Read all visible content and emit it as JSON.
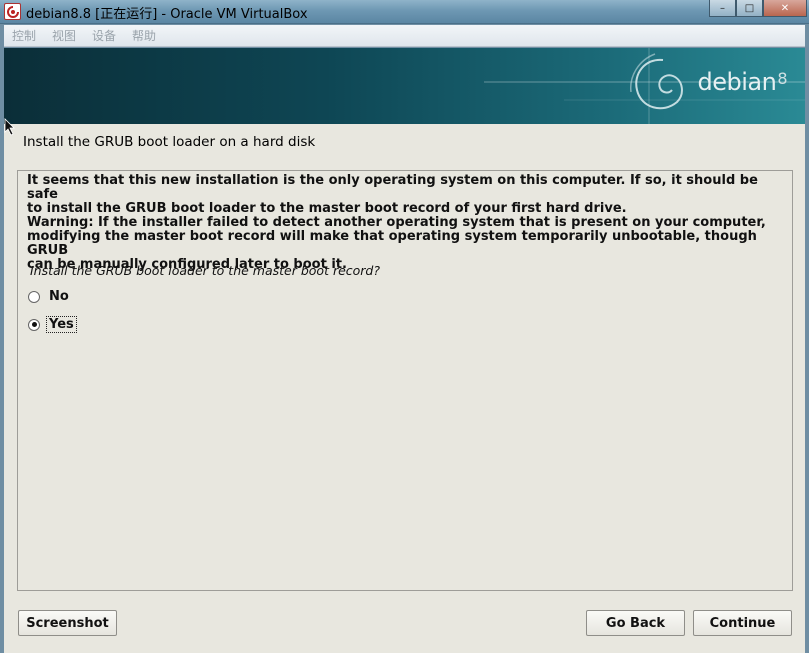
{
  "window": {
    "title": "debian8.8 [正在运行] - Oracle VM VirtualBox",
    "buttons": {
      "minimize": "–",
      "maximize": "□",
      "close": "✕"
    }
  },
  "menubar": [
    "控制",
    "视图",
    "设备",
    "帮助"
  ],
  "banner": {
    "logo_text": "debian",
    "logo_version": "8"
  },
  "installer": {
    "step_title": "Install the GRUB boot loader on a hard disk",
    "paragraph1": "It seems that this new installation is the only operating system on this computer. If so, it should be safe\nto install the GRUB boot loader to the master boot record of your first hard drive.",
    "paragraph2": "Warning: If the installer failed to detect another operating system that is present on your computer,\nmodifying the master boot record will make that operating system temporarily unbootable, though GRUB\ncan be manually configured later to boot it.",
    "question": "Install the GRUB boot loader to the master boot record?",
    "options": [
      {
        "label": "No",
        "selected": false
      },
      {
        "label": "Yes",
        "selected": true
      }
    ],
    "buttons": {
      "screenshot": "Screenshot",
      "go_back": "Go Back",
      "continue": "Continue"
    }
  }
}
